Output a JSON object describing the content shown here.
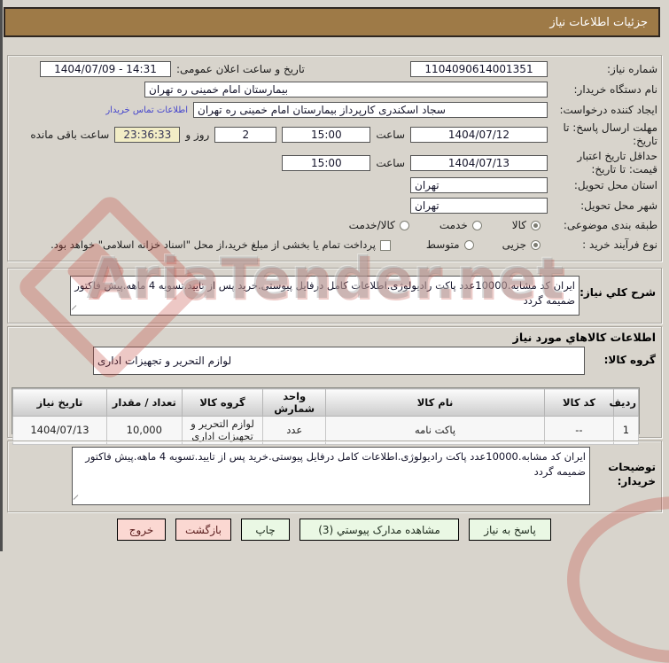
{
  "window": {
    "title": "جزئیات اطلاعات نیاز"
  },
  "watermark": {
    "text": "AriaTender.net"
  },
  "info": {
    "need_number_label": "شماره نیاز:",
    "need_number": "1104090614001351",
    "announce_label": "تاریخ و ساعت اعلان عمومی:",
    "announce_value": "1404/07/09 - 14:31",
    "buyer_org_label": "نام دستگاه خریدار:",
    "buyer_org": "بیمارستان امام خمینی ره  تهران",
    "creator_label": "ایجاد کننده درخواست:",
    "creator": "سجاد اسکندری کارپرداز بیمارستان امام خمینی ره  تهران",
    "contact_link": "اطلاعات تماس خریدار",
    "deadline_label": "مهلت ارسال پاسخ: تا تاریخ:",
    "deadline_date": "1404/07/12",
    "hour_label": "ساعت",
    "deadline_time": "15:00",
    "remaining_days": "2",
    "days_conj_label": "روز و",
    "remaining_time": "23:36:33",
    "remaining_suffix_label": "ساعت باقی مانده",
    "validity_label": "حداقل تاریخ اعتبار قیمت: تا تاریخ:",
    "validity_date": "1404/07/13",
    "validity_time": "15:00",
    "province_label": "استان محل تحویل:",
    "province": "تهران",
    "city_label": "شهر محل تحویل:",
    "city": "تهران",
    "classification_label": "طبقه بندی موضوعی:",
    "classification_options": [
      {
        "label": "کالا",
        "selected": true
      },
      {
        "label": "خدمت",
        "selected": false
      },
      {
        "label": "کالا/خدمت",
        "selected": false
      }
    ],
    "process_label": "نوع فرآیند خرید :",
    "process_options": [
      {
        "label": "جزیی",
        "selected": true
      },
      {
        "label": "متوسط",
        "selected": false
      }
    ],
    "treasury_checkbox": {
      "checked": false,
      "label": "پرداخت تمام یا بخشی از مبلغ خرید،از محل \"اسناد خزانه اسلامی\" خواهد بود."
    }
  },
  "description": {
    "label": "شرح کلي نیاز:",
    "text": "ایران کد مشابه.10000عدد پاکت رادیولوژی.اطلاعات کامل درفایل پیوستی.خرید پس از تایید.تسویه 4 ماهه.پیش فاکتور ضمیمه گردد"
  },
  "goods": {
    "section_header": "اطلاعات کالاهاي مورد نیاز",
    "group_label": "گروه کالا:",
    "group_value": "لوازم التحریر و تجهیزات اداری",
    "table": {
      "headers": [
        "ردیف",
        "کد کالا",
        "نام کالا",
        "واحد شمارش",
        "گروه کالا",
        "تعداد / مقدار",
        "تاریخ نیاز"
      ],
      "rows": [
        {
          "row_no": "1",
          "code": "--",
          "name": "پاکت نامه",
          "unit": "عدد",
          "group": "لوازم التحریر و تجهیزات اداری",
          "qty": "10,000",
          "need_date": "1404/07/13"
        }
      ]
    }
  },
  "notes": {
    "label": "توضیحات خریدار:",
    "text": "ایران کد مشابه.10000عدد پاکت رادیولوژی.اطلاعات کامل درفایل پیوستی.خرید پس از تایید.تسویه 4 ماهه.پیش فاکتور ضمیمه گردد"
  },
  "buttons": [
    {
      "label": "پاسخ به نیاز",
      "variant": "green"
    },
    {
      "label": "مشاهده مدارک پیوستي (3)",
      "variant": "green"
    },
    {
      "label": "چاپ",
      "variant": "green"
    },
    {
      "label": "بازگشت",
      "variant": "pink"
    },
    {
      "label": "خروج",
      "variant": "pink"
    }
  ],
  "colors": {
    "titlebar": "#9e7a47",
    "page_bg": "#d8d4cc",
    "link": "#4444cc",
    "countdown_bg": "#f2edc6",
    "button_green": "#eaf8e4",
    "button_pink": "#fbd8d2",
    "watermark_red": "#c34a3f"
  }
}
